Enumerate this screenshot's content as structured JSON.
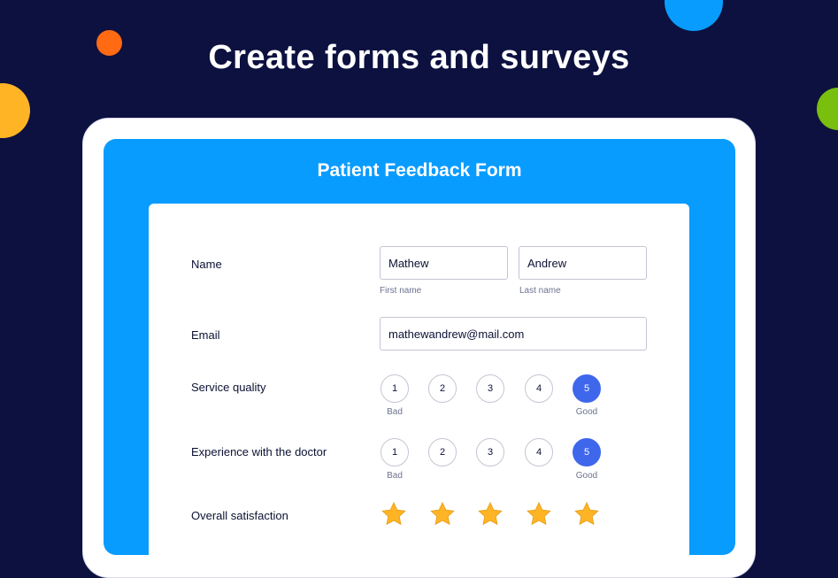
{
  "headline": "Create forms and surveys",
  "form": {
    "title": "Patient Feedback Form",
    "name": {
      "label": "Name",
      "first_value": "Mathew",
      "first_caption": "First name",
      "last_value": "Andrew",
      "last_caption": "Last name"
    },
    "email": {
      "label": "Email",
      "value": "mathewandrew@mail.com"
    },
    "service_quality": {
      "label": "Service quality",
      "options": [
        "1",
        "2",
        "3",
        "4",
        "5"
      ],
      "selected": "5",
      "low_caption": "Bad",
      "high_caption": "Good"
    },
    "doctor_experience": {
      "label": "Experience with the doctor",
      "options": [
        "1",
        "2",
        "3",
        "4",
        "5"
      ],
      "selected": "5",
      "low_caption": "Bad",
      "high_caption": "Good"
    },
    "overall_satisfaction": {
      "label": "Overall satisfaction",
      "stars_filled": 5,
      "stars_total": 5
    }
  },
  "colors": {
    "background": "#0d1140",
    "primary": "#099cff",
    "selected": "#3e67ec",
    "star": "#ffb425"
  },
  "icons": {
    "rating_star": "star-icon"
  }
}
